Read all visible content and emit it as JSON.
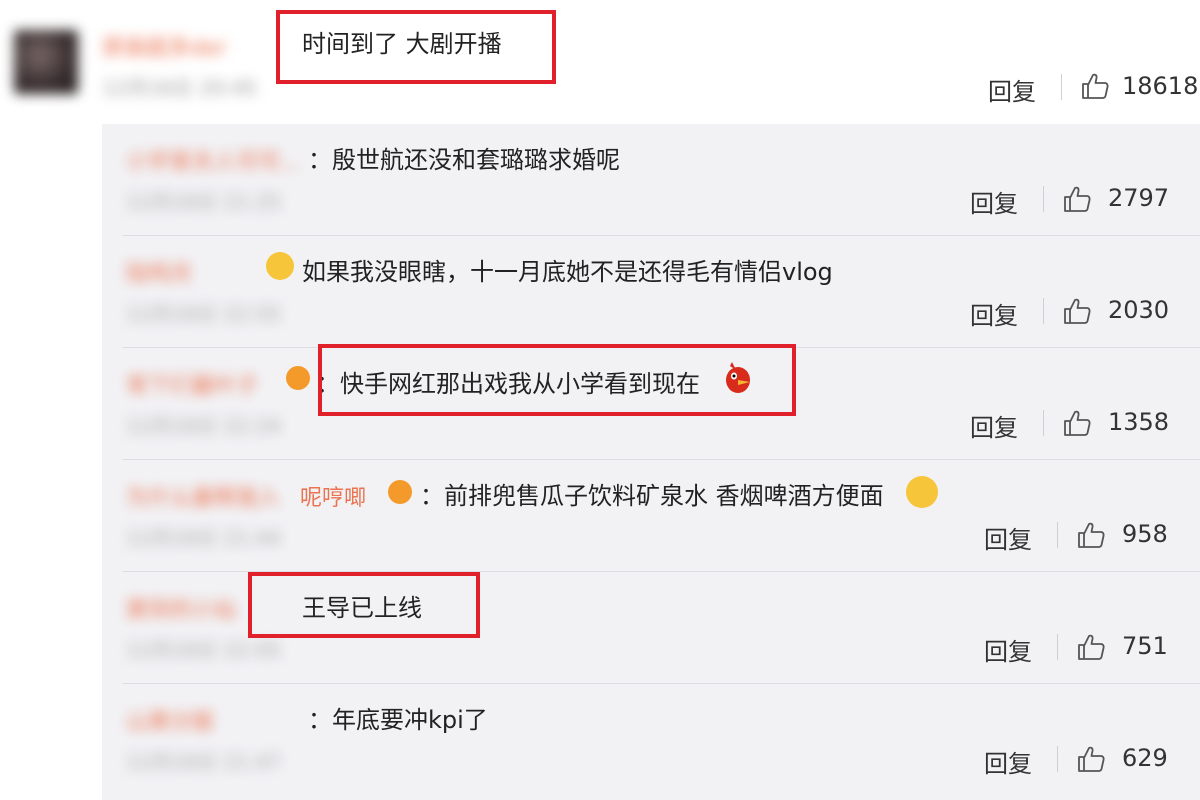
{
  "top_comment": {
    "name": "原装超多der",
    "time": "12月16日 20:45",
    "text": "时间到了 大剧开播",
    "reply_label": "回复",
    "likes": "18618"
  },
  "replies": [
    {
      "name": "小宇家夫人可可...",
      "time": "12月16日 21:25",
      "text": "：殷世航还没和套璐璐求婚呢",
      "reply_label": "回复",
      "likes": "2797"
    },
    {
      "name": "陆鸣月",
      "time": "12月16日 22:55",
      "text": "如果我没眼瞎，十一月底她不是还得毛有情侣vlog",
      "reply_label": "回复",
      "likes": "2030"
    },
    {
      "name": "常下们最叶子",
      "time": "12月16日 22:24",
      "text": "：快手网红那出戏我从小学看到现在",
      "reply_label": "回复",
      "likes": "1358"
    },
    {
      "name": "为什么最帮我入",
      "name_clear": "呢哼唧",
      "time": "12月16日 21:44",
      "text": "：前排兜售瓜子饮料矿泉水 香烟啤酒方便面",
      "reply_label": "回复",
      "likes": "958"
    },
    {
      "name": "窦突的小仙",
      "time": "12月16日 22:05",
      "text": "王导已上线",
      "reply_label": "回复",
      "likes": "751"
    },
    {
      "name": "山莱分版",
      "time": "12月16日 21:47",
      "text": "：年底要冲kpi了",
      "reply_label": "回复",
      "likes": "629"
    }
  ],
  "colors": {
    "highlight": "#e0202a",
    "username": "#eb7350",
    "panel": "#f2f2f5"
  },
  "icons": {
    "like": "thumbs-up-icon"
  }
}
